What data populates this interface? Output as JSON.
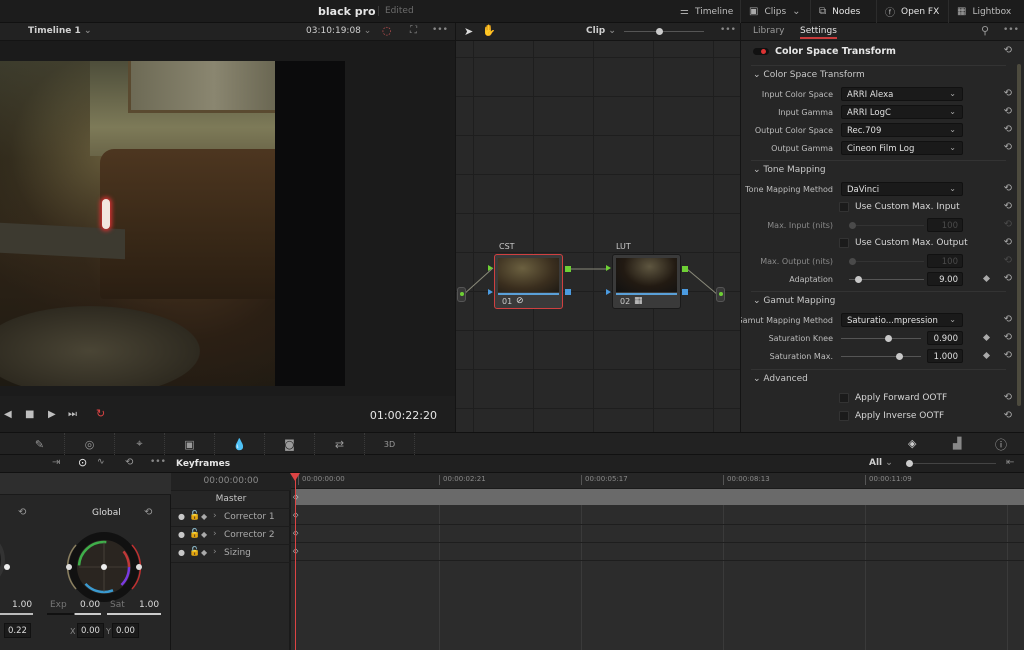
{
  "app": {
    "project_title": "black pro",
    "status": "Edited"
  },
  "top_nav": [
    {
      "icon": "timeline-icon",
      "label": "Timeline"
    },
    {
      "icon": "clips-icon",
      "label": "Clips"
    },
    {
      "icon": "nodes-icon",
      "label": "Nodes"
    },
    {
      "icon": "fx-icon",
      "label": "Open FX"
    },
    {
      "icon": "lightbox-icon",
      "label": "Lightbox"
    }
  ],
  "viewer": {
    "timeline_name": "Timeline 1",
    "source_timecode": "03:10:19:08",
    "playback_timecode": "01:00:22:20"
  },
  "node_graph": {
    "mode": "Clip",
    "zoom_fraction": 0.45,
    "nodes": [
      {
        "label": "CST",
        "number": "01",
        "icon": "fx-icon",
        "selected": true
      },
      {
        "label": "LUT",
        "number": "02",
        "icon": "lut-icon",
        "selected": false
      }
    ]
  },
  "settings_panel": {
    "tabs": [
      {
        "label": "Library",
        "active": false
      },
      {
        "label": "Settings",
        "active": true
      }
    ],
    "effect_name": "Color Space Transform",
    "sections": {
      "cst": "Color Space Transform",
      "tone": "Tone Mapping",
      "gamut": "Gamut Mapping",
      "advanced": "Advanced"
    },
    "input_color_space": {
      "label": "Input Color Space",
      "value": "ARRI Alexa"
    },
    "input_gamma": {
      "label": "Input Gamma",
      "value": "ARRI LogC"
    },
    "output_color_space": {
      "label": "Output Color Space",
      "value": "Rec.709"
    },
    "output_gamma": {
      "label": "Output Gamma",
      "value": "Cineon Film Log"
    },
    "tone_mapping_method": {
      "label": "Tone Mapping Method",
      "value": "DaVinci"
    },
    "use_custom_max_input": {
      "label": "Use Custom Max. Input",
      "checked": false
    },
    "max_input": {
      "label": "Max. Input (nits)",
      "value": "100",
      "slider": 0.0
    },
    "use_custom_max_output": {
      "label": "Use Custom Max. Output",
      "checked": false
    },
    "max_output": {
      "label": "Max. Output (nits)",
      "value": "100",
      "slider": 0.0
    },
    "adaptation": {
      "label": "Adaptation",
      "value": "9.00",
      "slider": 0.09
    },
    "gamut_mapping_method": {
      "label": "Gamut Mapping Method",
      "value": "Saturatio...mpression"
    },
    "saturation_knee": {
      "label": "Saturation Knee",
      "value": "0.900",
      "slider": 0.6
    },
    "saturation_max": {
      "label": "Saturation Max.",
      "value": "1.000",
      "slider": 0.75
    },
    "apply_forward_ootf": {
      "label": "Apply Forward OOTF",
      "checked": false
    },
    "apply_inverse_ootf": {
      "label": "Apply Inverse OOTF",
      "checked": false
    }
  },
  "color_wheels": {
    "global_label": "Global",
    "left_value": "1.00",
    "exp_label": "Exp",
    "exp_value": "0.00",
    "sat_label": "Sat",
    "sat_value": "1.00",
    "left_field": "0.22",
    "x_label": "X",
    "x_value": "0.00",
    "y_label": "Y",
    "y_value": "0.00"
  },
  "keyframes": {
    "title": "Keyframes",
    "filter": "All",
    "current_time": "00:00:00:00",
    "tracks": [
      "Master",
      "Corrector 1",
      "Corrector 2",
      "Sizing"
    ],
    "ruler": [
      "00:00:00:00",
      "00:00:02:21",
      "00:00:05:17",
      "00:00:08:13",
      "00:00:11:09"
    ]
  },
  "colors": {
    "accent_red": "#d44444",
    "node_green": "#6ed035",
    "node_blue": "#4b9be0"
  }
}
